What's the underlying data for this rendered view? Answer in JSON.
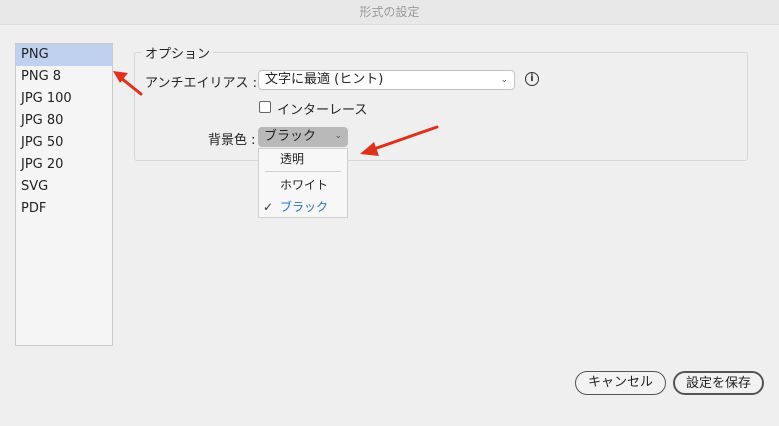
{
  "window": {
    "title": "形式の設定"
  },
  "format_list": {
    "items": [
      "PNG",
      "PNG 8",
      "JPG 100",
      "JPG 80",
      "JPG 50",
      "JPG 20",
      "SVG",
      "PDF"
    ],
    "selected": "PNG"
  },
  "options": {
    "group_title": "オプション",
    "antialias": {
      "label": "アンチエイリアス :",
      "value": "文字に最適 (ヒント)"
    },
    "interlace": {
      "label": "インターレース",
      "checked": false
    },
    "background": {
      "label": "背景色 :",
      "value": "ブラック",
      "menu_items": [
        "透明",
        "ホワイト",
        "ブラック"
      ],
      "checked_item": "ブラック"
    }
  },
  "buttons": {
    "cancel": "キャンセル",
    "save": "設定を保存"
  },
  "colors": {
    "selection": "#bfd1ee",
    "arrow": "#e1301b",
    "checked_text": "#2a6fd6"
  },
  "icons": {
    "info": "info-icon",
    "chevron": "chevron-down-icon",
    "check": "checkmark-icon"
  }
}
